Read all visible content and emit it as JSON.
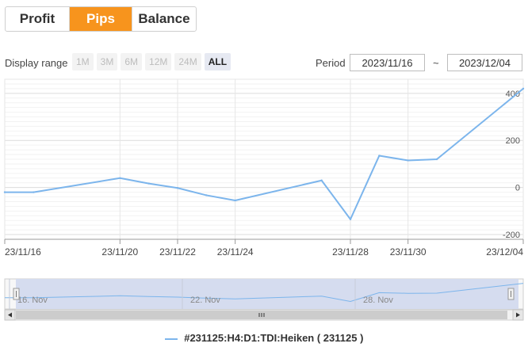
{
  "tabs": [
    {
      "label": "Profit",
      "active": false
    },
    {
      "label": "Pips",
      "active": true
    },
    {
      "label": "Balance",
      "active": false
    }
  ],
  "display_range": {
    "label": "Display range",
    "buttons": [
      {
        "label": "1M",
        "active": false
      },
      {
        "label": "3M",
        "active": false
      },
      {
        "label": "6M",
        "active": false
      },
      {
        "label": "12M",
        "active": false
      },
      {
        "label": "24M",
        "active": false
      },
      {
        "label": "ALL",
        "active": true
      }
    ]
  },
  "period": {
    "label": "Period",
    "start": "2023/11/16",
    "separator": "~",
    "end": "2023/12/04"
  },
  "colors": {
    "accent": "#f7941d",
    "series": "#7cb5ec",
    "navigator_fill": "#d5dcef"
  },
  "chart_data": {
    "type": "line",
    "xlabel": "",
    "ylabel": "",
    "x_tick_labels": [
      "23/11/16",
      "23/11/20",
      "23/11/22",
      "23/11/24",
      "23/11/28",
      "23/11/30",
      "23/12/04"
    ],
    "y_ticks": [
      400,
      200,
      0,
      -200
    ],
    "ylim": [
      -220,
      460
    ],
    "grid": true,
    "legend_placement": "bottom-center",
    "series": [
      {
        "name": "#231125:H4:D1:TDI:Heiken ( 231125 )",
        "points": [
          {
            "x": "2023/11/16",
            "y": -20
          },
          {
            "x": "2023/11/17",
            "y": -20
          },
          {
            "x": "2023/11/20",
            "y": 40
          },
          {
            "x": "2023/11/21",
            "y": 17
          },
          {
            "x": "2023/11/22",
            "y": -2
          },
          {
            "x": "2023/11/23",
            "y": -33
          },
          {
            "x": "2023/11/24",
            "y": -55
          },
          {
            "x": "2023/11/27",
            "y": 30
          },
          {
            "x": "2023/11/28",
            "y": -135
          },
          {
            "x": "2023/11/29",
            "y": 135
          },
          {
            "x": "2023/11/30",
            "y": 115
          },
          {
            "x": "2023/12/01",
            "y": 120
          },
          {
            "x": "2023/12/04",
            "y": 420
          }
        ]
      }
    ],
    "navigator": {
      "labels": [
        "16. Nov",
        "22. Nov",
        "28. Nov"
      ]
    }
  }
}
